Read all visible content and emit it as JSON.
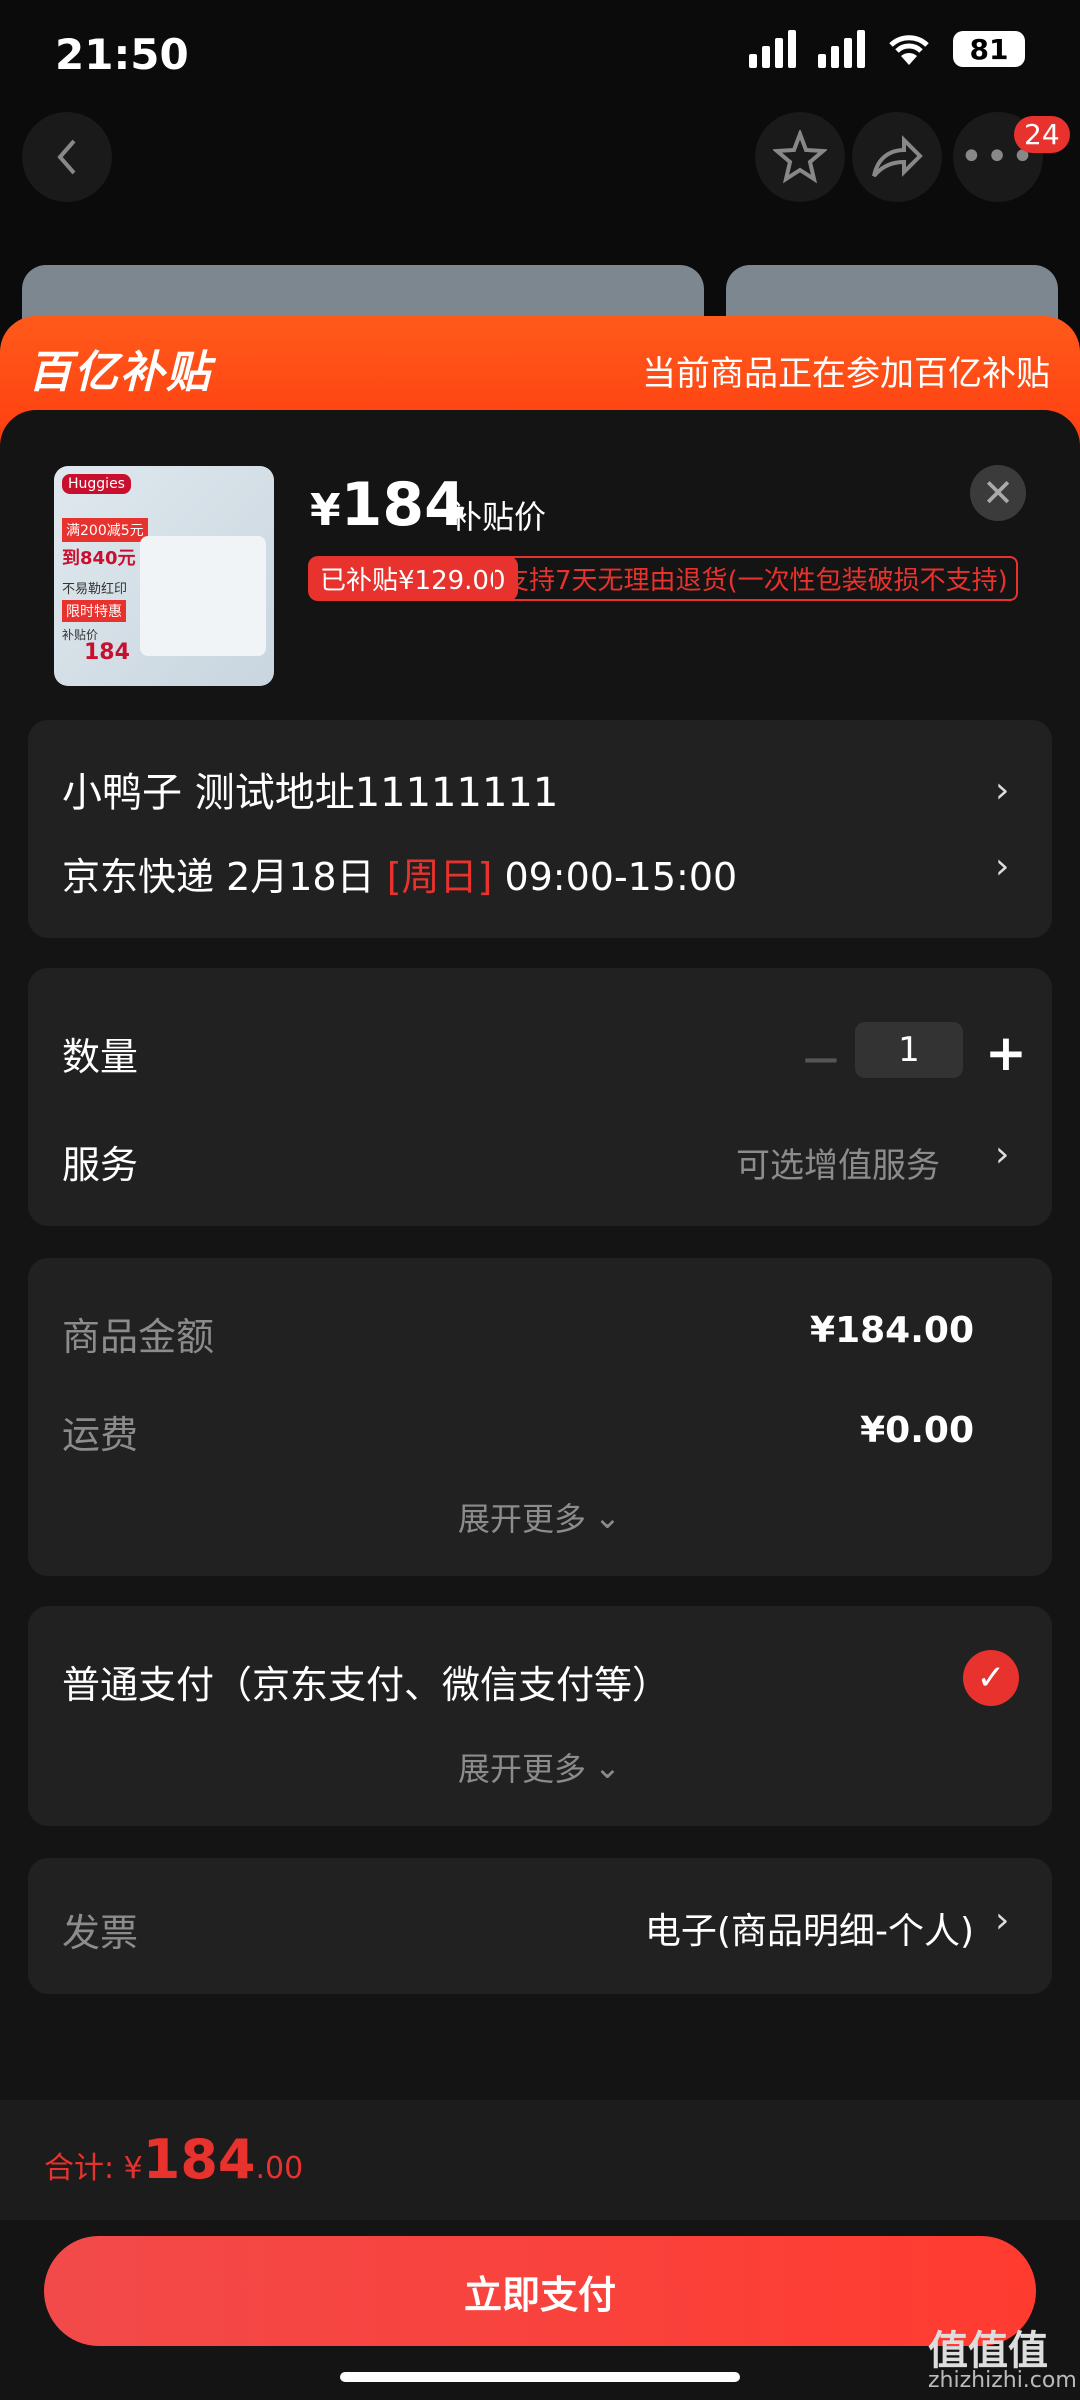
{
  "status": {
    "time": "21:50",
    "battery": "81"
  },
  "nav": {
    "badge_count": "24"
  },
  "banner": {
    "logo": "百亿补贴",
    "text": "当前商品正在参加百亿补贴"
  },
  "product": {
    "currency": "¥",
    "price": "184",
    "price_label": "补贴价",
    "subsidy_badge": "已补贴¥129.00",
    "return_badge": "支持7天无理由退货(一次性包装破损不支持)",
    "thumb_text": {
      "brand": "Huggies",
      "promo1": "满200减5元",
      "promo2": "到840元",
      "promo3": "不易勒红印",
      "promo4": "限时特惠",
      "promo5": "补贴价",
      "promo6": "184"
    }
  },
  "address": {
    "line": "小鸭子  测试地址11111111",
    "carrier": "京东快递 2月18日 ",
    "weekday": "[周日]",
    "time_range": " 09:00-15:00"
  },
  "quantity": {
    "label": "数量",
    "minus": "−",
    "value": "1",
    "plus": "+"
  },
  "service": {
    "label": "服务",
    "value": "可选增值服务"
  },
  "amounts": {
    "goods_label": "商品金额",
    "goods_value": "¥184.00",
    "shipping_label": "运费",
    "shipping_value": "¥0.00",
    "expand": "展开更多"
  },
  "payment": {
    "method": "普通支付（京东支付、微信支付等）",
    "expand": "展开更多"
  },
  "invoice": {
    "label": "发票",
    "value": "电子(商品明细-个人)"
  },
  "total": {
    "label": "合计: ",
    "currency": "¥",
    "integer": "184",
    "decimal": ".00"
  },
  "pay_button": "立即支付",
  "watermark": {
    "logo": "值值值",
    "site": "zhizhizhi.com"
  },
  "colors": {
    "accent": "#e8322d",
    "banner": "#ff4a14",
    "panel": "#212121"
  }
}
